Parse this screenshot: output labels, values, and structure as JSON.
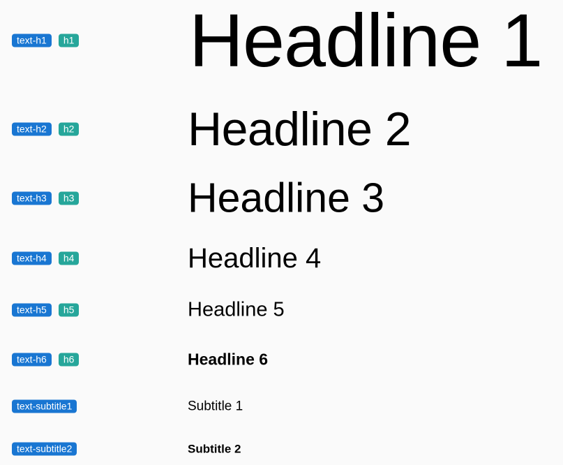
{
  "colors": {
    "background": "#fafafa",
    "class_chip": "#1976d2",
    "tag_chip": "#26a69a",
    "text": "#000000"
  },
  "rows": [
    {
      "class_label": "text-h1",
      "tag_label": "h1",
      "sample": "Headline 1"
    },
    {
      "class_label": "text-h2",
      "tag_label": "h2",
      "sample": "Headline 2"
    },
    {
      "class_label": "text-h3",
      "tag_label": "h3",
      "sample": "Headline 3"
    },
    {
      "class_label": "text-h4",
      "tag_label": "h4",
      "sample": "Headline 4"
    },
    {
      "class_label": "text-h5",
      "tag_label": "h5",
      "sample": "Headline 5"
    },
    {
      "class_label": "text-h6",
      "tag_label": "h6",
      "sample": "Headline 6"
    },
    {
      "class_label": "text-subtitle1",
      "sample": "Subtitle 1"
    },
    {
      "class_label": "text-subtitle2",
      "sample": "Subtitle 2"
    }
  ]
}
